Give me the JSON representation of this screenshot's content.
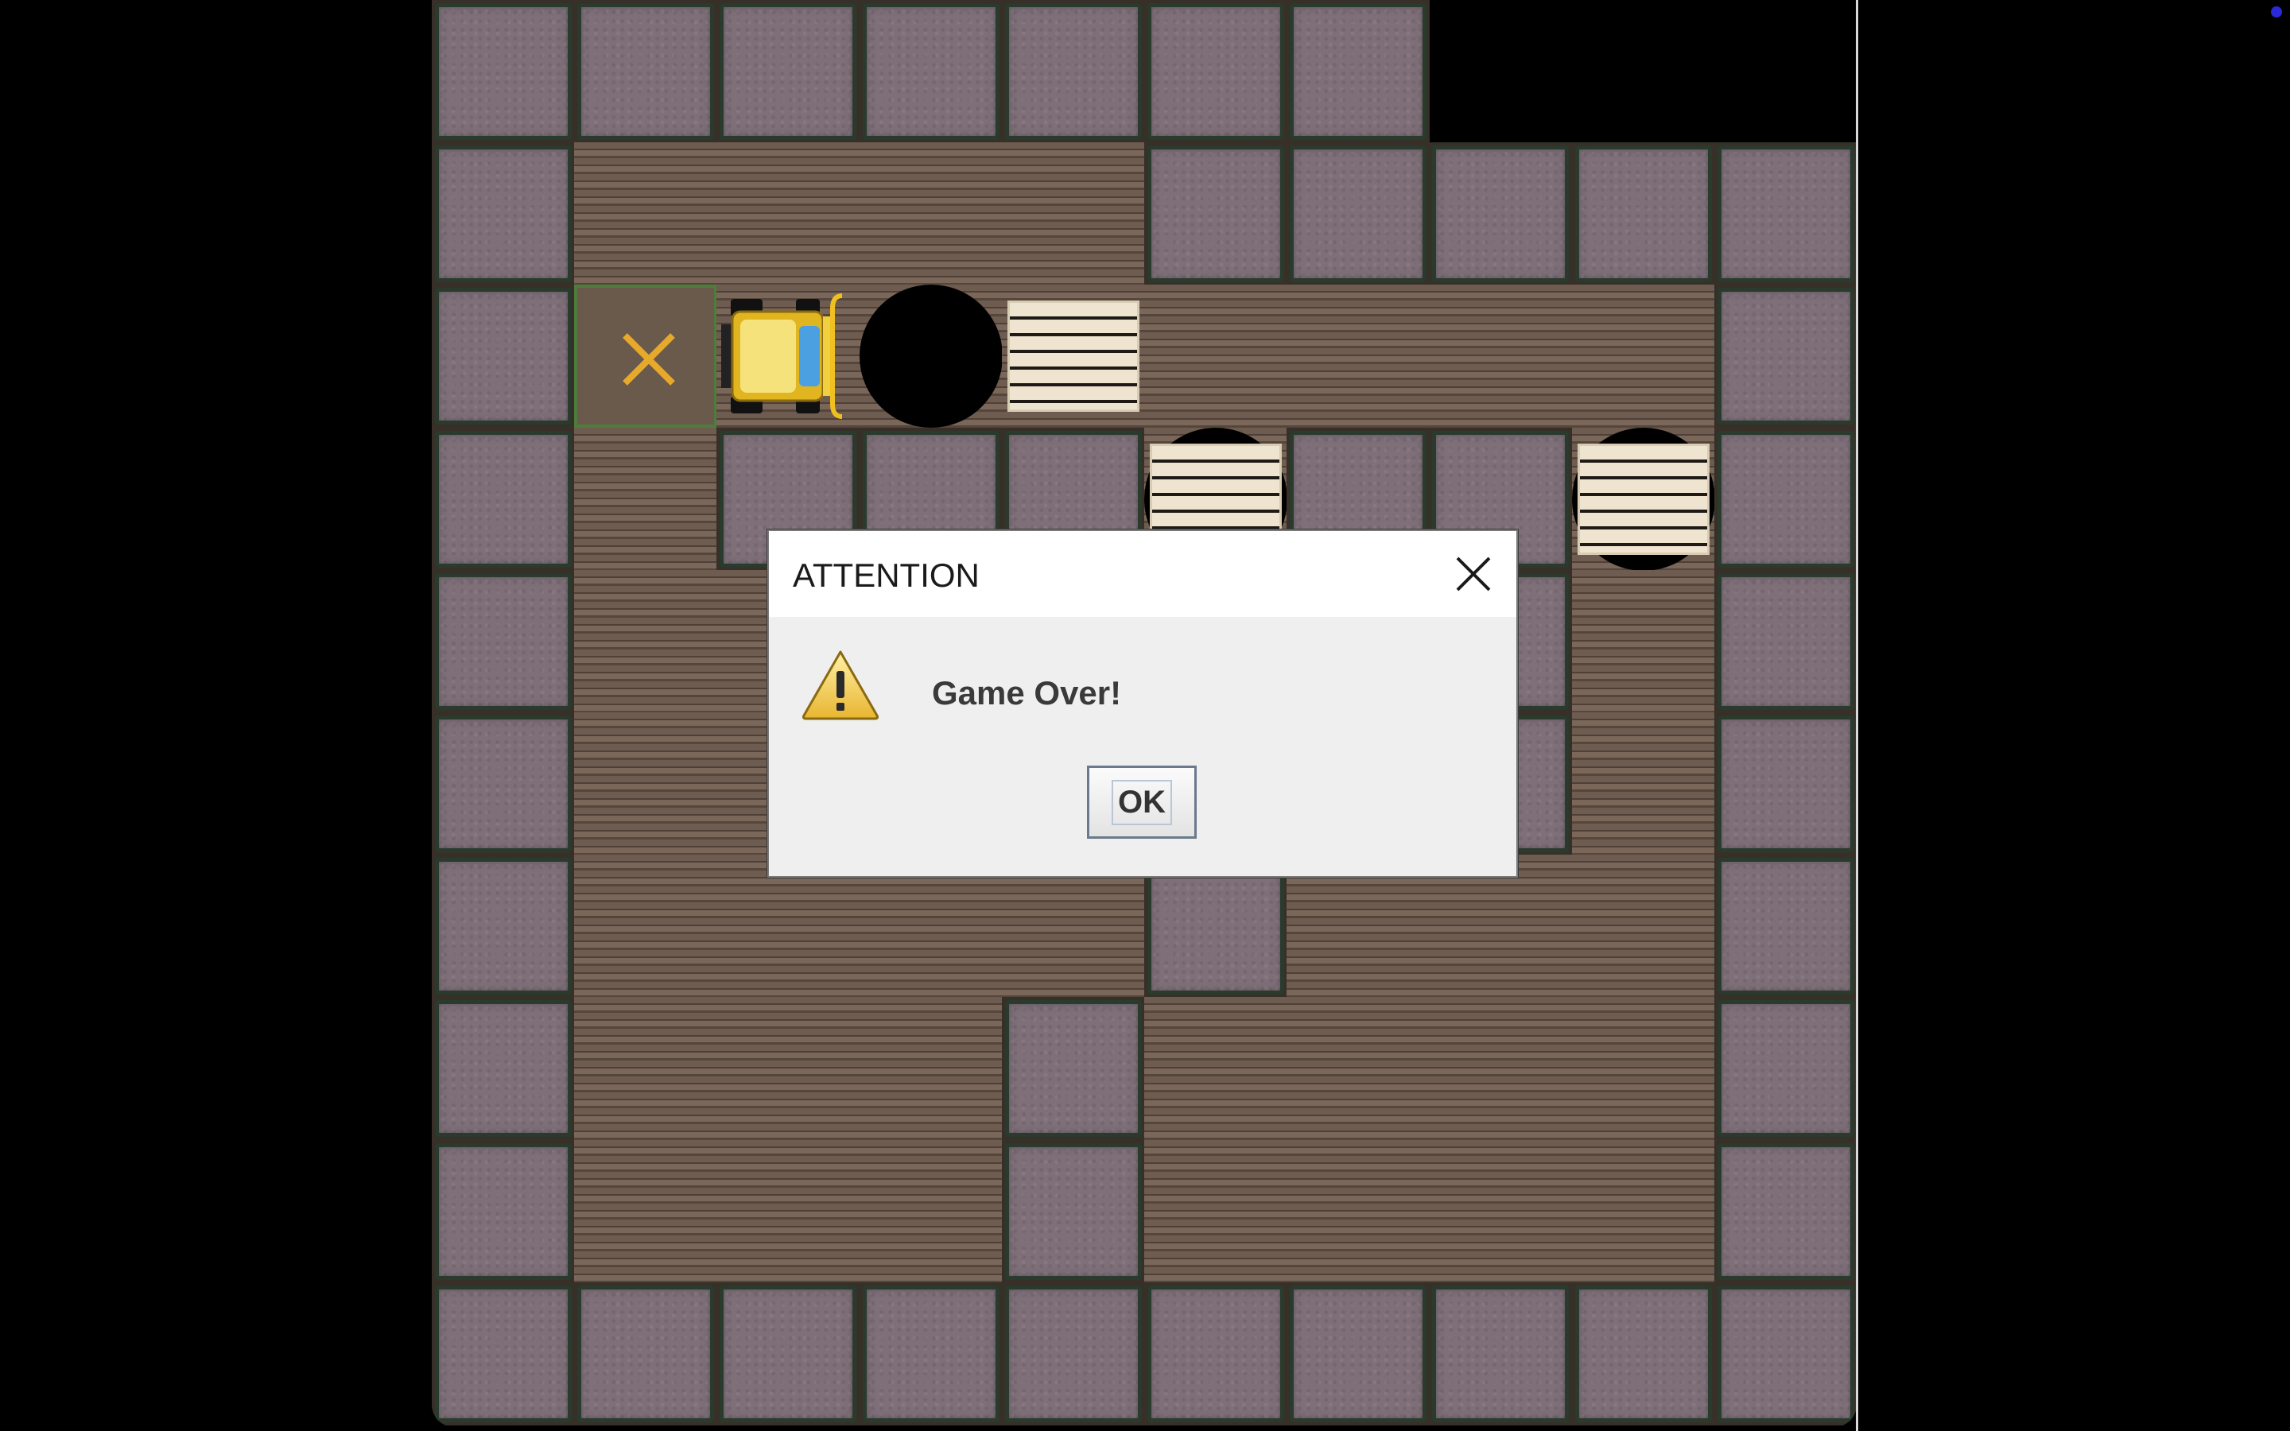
{
  "dialog": {
    "title": "ATTENTION",
    "message": "Game Over!",
    "ok_label": "OK",
    "icon": "warning-icon"
  },
  "game": {
    "name": "sokoban-warehouse",
    "grid_cols": 10,
    "grid_rows": 10,
    "legend": {
      "W": "wall",
      ".": "floor",
      "G": "goal",
      "H": "hole",
      "P": "pallet-on-floor",
      "B": "pallet-in-hole",
      "F": "forklift",
      " ": "empty"
    },
    "map": [
      "WWWWWWW   ",
      "W....WWWWW",
      "WGFHP....W",
      "W.WWWBWWBW",
      "W..WW..W.W",
      "W..WW..W.W",
      "W....W...W",
      "W...W....W",
      "W...W....W",
      "WWWWWWWWWW"
    ],
    "forklift_facing": "right",
    "status": "game-over"
  },
  "colors": {
    "background": "#000000",
    "wall": "#7e6f79",
    "floor": "#6e5c50",
    "goal_border": "#4e7d3b",
    "goal_mark": "#e7a92a",
    "pallet": "#efe4cf",
    "dialog_bg": "#efefef"
  }
}
